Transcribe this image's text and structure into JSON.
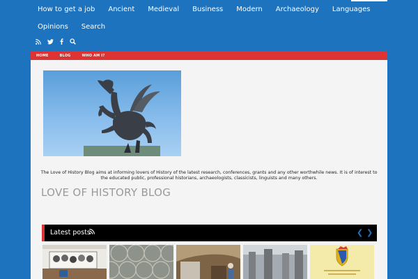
{
  "nav": {
    "row1": [
      "How to get a job",
      "Ancient",
      "Medieval",
      "Business",
      "Modern",
      "Archaeology",
      "Languages"
    ],
    "row2": [
      "Opinions",
      "Search"
    ]
  },
  "social": [
    "rss-icon",
    "twitter-icon",
    "facebook-icon",
    "search-icon"
  ],
  "submenu": [
    "HOME",
    "BLOG",
    "WHO AM I?"
  ],
  "hero_image": "Bronze winged horse statue against blue sky",
  "description": "The Love of History Blog aims at informing lovers of History of the latest research, conferences, grants and any other worthwhile news. It is of interest to the educated public, professional historians, archaeologists, classicists, linguists and many others.",
  "blog_title": "LOVE OF HISTORY BLOG",
  "latest": {
    "label": "Latest posts",
    "prev": "❮",
    "next": "❯"
  },
  "colors": {
    "brand": "#1e73be",
    "accent": "#dd3333",
    "content_bg": "#f4f4f4"
  }
}
